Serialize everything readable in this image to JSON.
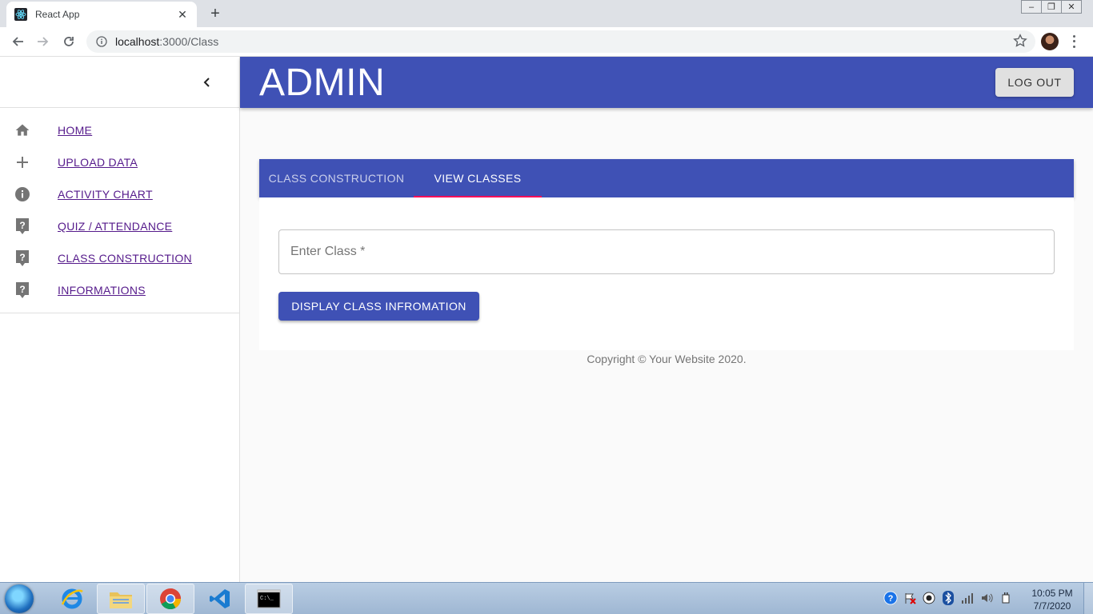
{
  "browser": {
    "tab_title": "React App",
    "url_host": "localhost",
    "url_path": ":3000/Class"
  },
  "sidebar": {
    "items": [
      {
        "label": "HOME",
        "icon": "home-icon"
      },
      {
        "label": "UPLOAD DATA",
        "icon": "plus-icon"
      },
      {
        "label": "ACTIVITY CHART",
        "icon": "info-icon"
      },
      {
        "label": "QUIZ / ATTENDANCE",
        "icon": "help-icon"
      },
      {
        "label": "CLASS CONSTRUCTION",
        "icon": "help-icon"
      },
      {
        "label": "INFORMATIONS",
        "icon": "help-icon"
      }
    ]
  },
  "header": {
    "title": "ADMIN",
    "logout_label": "LOG OUT"
  },
  "tabs": [
    {
      "label": "CLASS CONSTRUCTION",
      "selected": false
    },
    {
      "label": "VIEW CLASSES",
      "selected": true
    }
  ],
  "form": {
    "class_placeholder": "Enter Class *",
    "display_button": "DISPLAY CLASS INFROMATION"
  },
  "footer": {
    "copyright": "Copyright © Your Website 2020."
  },
  "taskbar": {
    "time": "10:05 PM",
    "date": "7/7/2020"
  },
  "colors": {
    "primary": "#3f51b5",
    "tab_indicator": "#f50057",
    "link": "#551a8b"
  }
}
